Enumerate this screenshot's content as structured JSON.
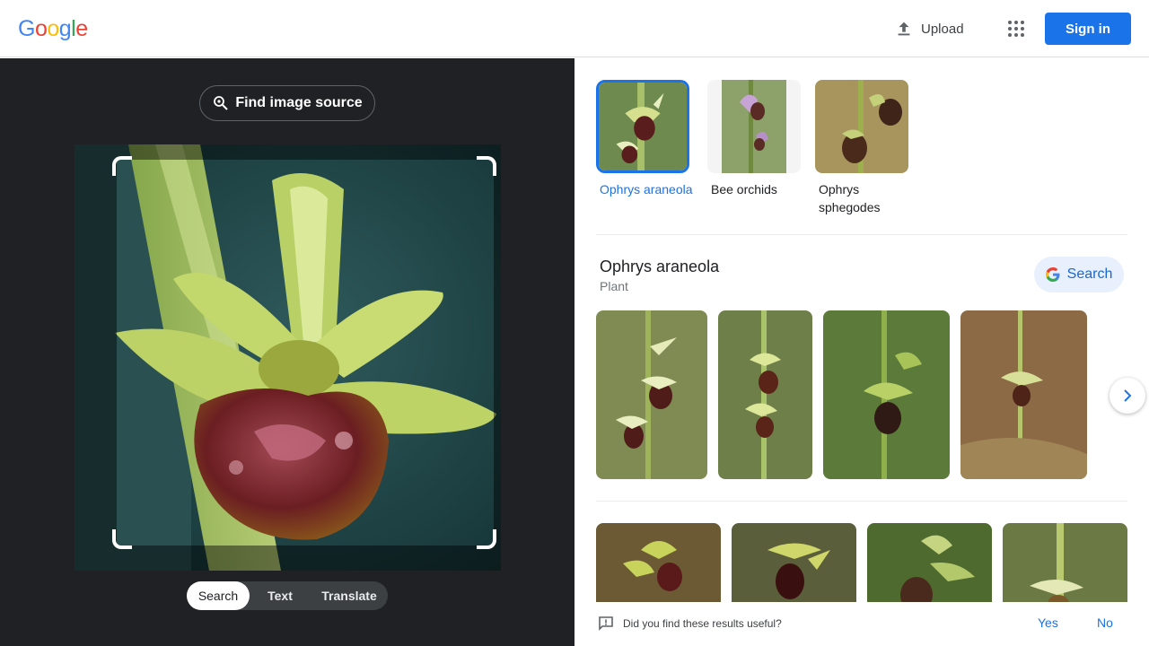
{
  "header": {
    "logo_letters": [
      "G",
      "o",
      "o",
      "g",
      "l",
      "e"
    ],
    "logo_colors": [
      "#4285F4",
      "#EA4335",
      "#FBBC05",
      "#4285F4",
      "#34A853",
      "#EA4335"
    ],
    "upload_label": "Upload",
    "signin_label": "Sign in",
    "icons": {
      "upload": "upload-icon",
      "apps": "apps-grid-icon"
    }
  },
  "left": {
    "find_source_label": "Find image source",
    "find_source_icon": "lens-search-icon",
    "modes": [
      {
        "label": "Search",
        "active": true
      },
      {
        "label": "Text",
        "active": false
      },
      {
        "label": "Translate",
        "active": false
      }
    ]
  },
  "right": {
    "entity_chips": [
      {
        "label": "Ophrys araneola",
        "selected": true
      },
      {
        "label": "Bee orchids",
        "selected": false
      },
      {
        "label": "Ophrys sphegodes",
        "selected": false
      }
    ],
    "knowledge_panel": {
      "title": "Ophrys araneola",
      "subtitle": "Plant",
      "search_label": "Search",
      "search_icon": "google-g-icon",
      "next_icon": "chevron-right-icon"
    },
    "feedback": {
      "question": "Did you find these results useful?",
      "yes_label": "Yes",
      "no_label": "No",
      "icon": "feedback-icon"
    }
  },
  "colors": {
    "accent": "#1a73e8",
    "dark_pane": "#202124",
    "search_chip_bg": "#e8f0fe"
  }
}
